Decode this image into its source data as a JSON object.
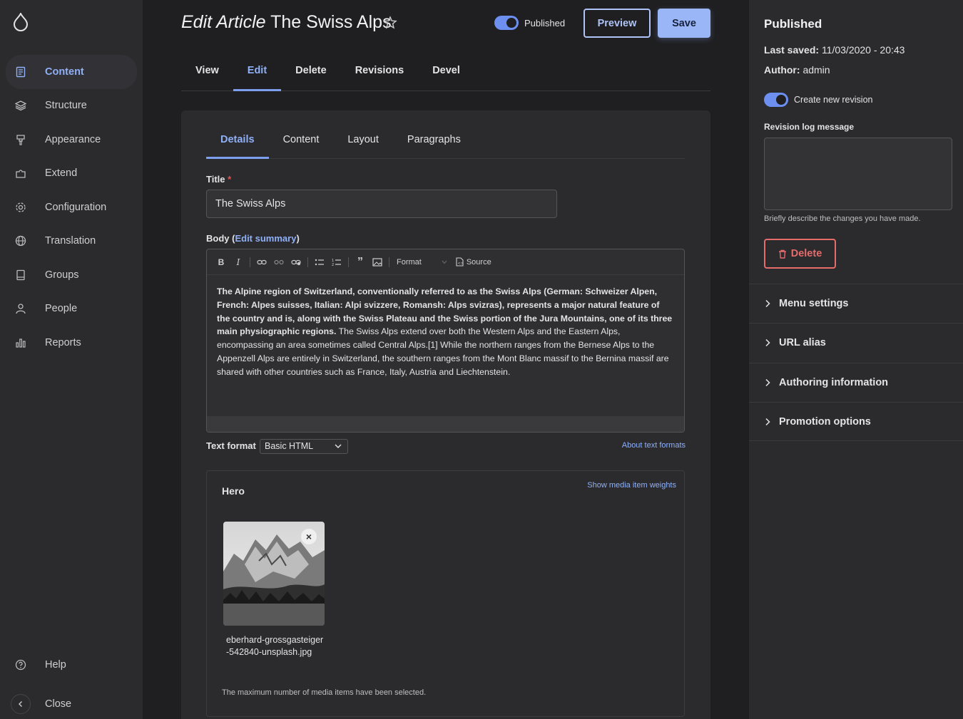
{
  "sidebar": {
    "items": [
      {
        "label": "Content",
        "icon": "document-icon",
        "active": true
      },
      {
        "label": "Structure",
        "icon": "layers-icon"
      },
      {
        "label": "Appearance",
        "icon": "brush-icon"
      },
      {
        "label": "Extend",
        "icon": "puzzle-icon"
      },
      {
        "label": "Configuration",
        "icon": "gear-icon"
      },
      {
        "label": "Translation",
        "icon": "globe-icon"
      },
      {
        "label": "Groups",
        "icon": "book-icon"
      },
      {
        "label": "People",
        "icon": "user-icon"
      },
      {
        "label": "Reports",
        "icon": "bar-chart-icon"
      }
    ],
    "help_label": "Help",
    "close_label": "Close"
  },
  "header": {
    "title_prefix": "Edit Article",
    "title_name": "The Swiss Alps",
    "published_label": "Published",
    "preview_label": "Preview",
    "save_label": "Save"
  },
  "primary_tabs": [
    "View",
    "Edit",
    "Delete",
    "Revisions",
    "Devel"
  ],
  "secondary_tabs": [
    "Details",
    "Content",
    "Layout",
    "Paragraphs"
  ],
  "form": {
    "title_label": "Title",
    "title_value": "The Swiss Alps",
    "body_label_start": "Body (",
    "body_edit_summary": "Edit summary",
    "body_label_end": ")",
    "toolbar": {
      "format_label": "Format",
      "source_label": "Source"
    },
    "body_bold": "The Alpine region of Switzerland, conventionally referred to as the Swiss Alps (German: Schweizer Alpen, French: Alpes suisses, Italian: Alpi svizzere, Romansh: Alps svizras), represents a major natural feature of the country and is, along with the Swiss Plateau and the Swiss portion of the Jura Mountains, one of its three main physiographic regions.",
    "body_rest": " The Swiss Alps extend over both the Western Alps and the Eastern Alps, encompassing an area sometimes called Central Alps.[1] While the northern ranges from the Bernese Alps to the Appenzell Alps are entirely in Switzerland, the southern ranges from the Mont Blanc massif to the Bernina massif are shared with other countries such as France, Italy, Austria and Liechtenstein.",
    "text_format_label": "Text format",
    "text_format_value": "Basic HTML",
    "about_text_formats": "About text formats"
  },
  "hero": {
    "title": "Hero",
    "weights_link": "Show media item weights",
    "file_name": "eberhard-grossgasteiger-542840-unsplash.jpg",
    "max_note": "The maximum number of media items have been selected."
  },
  "right_panel": {
    "status": "Published",
    "last_saved_label": "Last saved:",
    "last_saved_value": "11/03/2020 - 20:43",
    "author_label": "Author:",
    "author_value": "admin",
    "new_revision_label": "Create new revision",
    "revision_log_label": "Revision log message",
    "revision_help": "Briefly describe the changes you have made.",
    "delete_label": "Delete",
    "accordion": [
      "Menu settings",
      "URL alias",
      "Authoring information",
      "Promotion options"
    ]
  },
  "colors": {
    "accent": "#8fb0f7",
    "danger": "#e66b6b",
    "background": "#1f1f21",
    "panel": "#2b2b2e"
  }
}
